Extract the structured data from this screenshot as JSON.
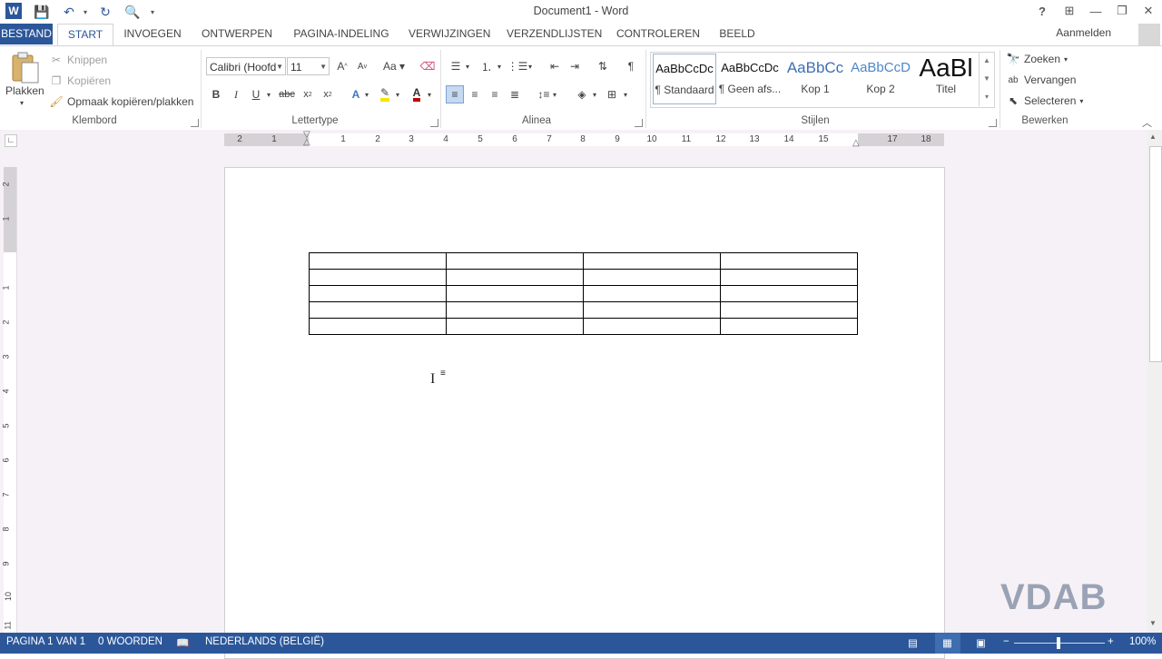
{
  "window": {
    "title": "Document1 - Word",
    "controls": [
      "?",
      "❐",
      "—",
      "❐",
      "✕"
    ]
  },
  "tabs": {
    "file": "BESTAND",
    "items": [
      "START",
      "INVOEGEN",
      "ONTWERPEN",
      "PAGINA-INDELING",
      "VERWIJZINGEN",
      "VERZENDLIJSTEN",
      "CONTROLEREN",
      "BEELD"
    ],
    "active": "START",
    "sign_in": "Aanmelden"
  },
  "ribbon": {
    "clipboard": {
      "label": "Klembord",
      "paste": "Plakken",
      "cut": "Knippen",
      "copy": "Kopiëren",
      "format_painter": "Opmaak kopiëren/plakken"
    },
    "font": {
      "label": "Lettertype",
      "font_name": "Calibri (Hoofd",
      "font_size": "11"
    },
    "paragraph": {
      "label": "Alinea"
    },
    "styles": {
      "label": "Stijlen",
      "items": [
        {
          "sample": "AaBbCcDc",
          "name": "¶ Standaard"
        },
        {
          "sample": "AaBbCcDc",
          "name": "¶ Geen afs..."
        },
        {
          "sample": "AaBbCc",
          "name": "Kop 1"
        },
        {
          "sample": "AaBbCcD",
          "name": "Kop 2"
        },
        {
          "sample": "AaBl",
          "name": "Titel"
        }
      ]
    },
    "editing": {
      "label": "Bewerken",
      "find": "Zoeken",
      "replace": "Vervangen",
      "select": "Selecteren"
    }
  },
  "ruler": {
    "numbers": [
      "2",
      "1",
      "1",
      "2",
      "3",
      "4",
      "5",
      "6",
      "7",
      "8",
      "9",
      "10",
      "11",
      "12",
      "13",
      "14",
      "15",
      "17",
      "18"
    ],
    "vertical": [
      "2",
      "1",
      "1",
      "2",
      "3",
      "4",
      "5",
      "6",
      "7",
      "8",
      "9",
      "10",
      "11"
    ]
  },
  "document": {
    "table": {
      "rows": 5,
      "cols": 4
    }
  },
  "status": {
    "page": "PAGINA 1 VAN 1",
    "words": "0 WOORDEN",
    "language": "NEDERLANDS (BELGIË)",
    "zoom": "100%"
  },
  "watermark": "VDAB",
  "colors": {
    "accent": "#2b579a",
    "doc_background": "#f6f1f6"
  }
}
